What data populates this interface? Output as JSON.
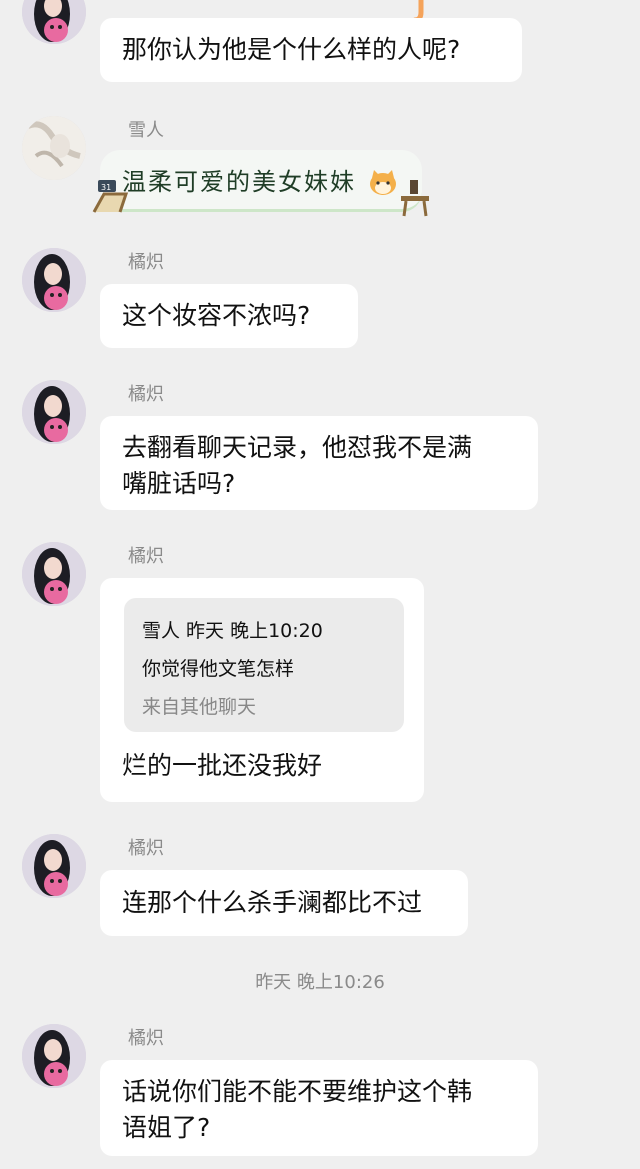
{
  "messages": [
    {
      "sender": "",
      "text": "那你认为他是个什么样的人呢?"
    },
    {
      "sender": "雪人",
      "text": "温柔可爱的美女妹妹"
    },
    {
      "sender": "橘炽",
      "text": "这个妆容不浓吗?"
    },
    {
      "sender": "橘炽",
      "line1": "去翻看聊天记录，他怼我不是满",
      "line2": "嘴脏话吗?"
    },
    {
      "sender": "橘炽",
      "quote": {
        "header": "雪人  昨天  晚上10:20",
        "text": "你觉得他文笔怎样",
        "from": "来自其他聊天"
      },
      "text": "烂的一批还没我好"
    },
    {
      "sender": "橘炽",
      "text": "连那个什么杀手澜都比不过"
    },
    {
      "sender": "橘炽",
      "line1": "话说你们能不能不要维护这个韩",
      "line2": "语姐了?"
    }
  ],
  "timestamp": "昨天  晚上10:26",
  "colors": {
    "background": "#efefef",
    "bubble": "#ffffff",
    "quote_bg": "#ebebeb",
    "meta_text": "#8a8a8a",
    "accent_orange": "#f5a35a"
  },
  "icons": [
    "girl-avatar-icon",
    "snowman-avatar-icon",
    "shiba-emoji-icon",
    "deck-chair-sticker-icon",
    "side-table-sticker-icon"
  ]
}
